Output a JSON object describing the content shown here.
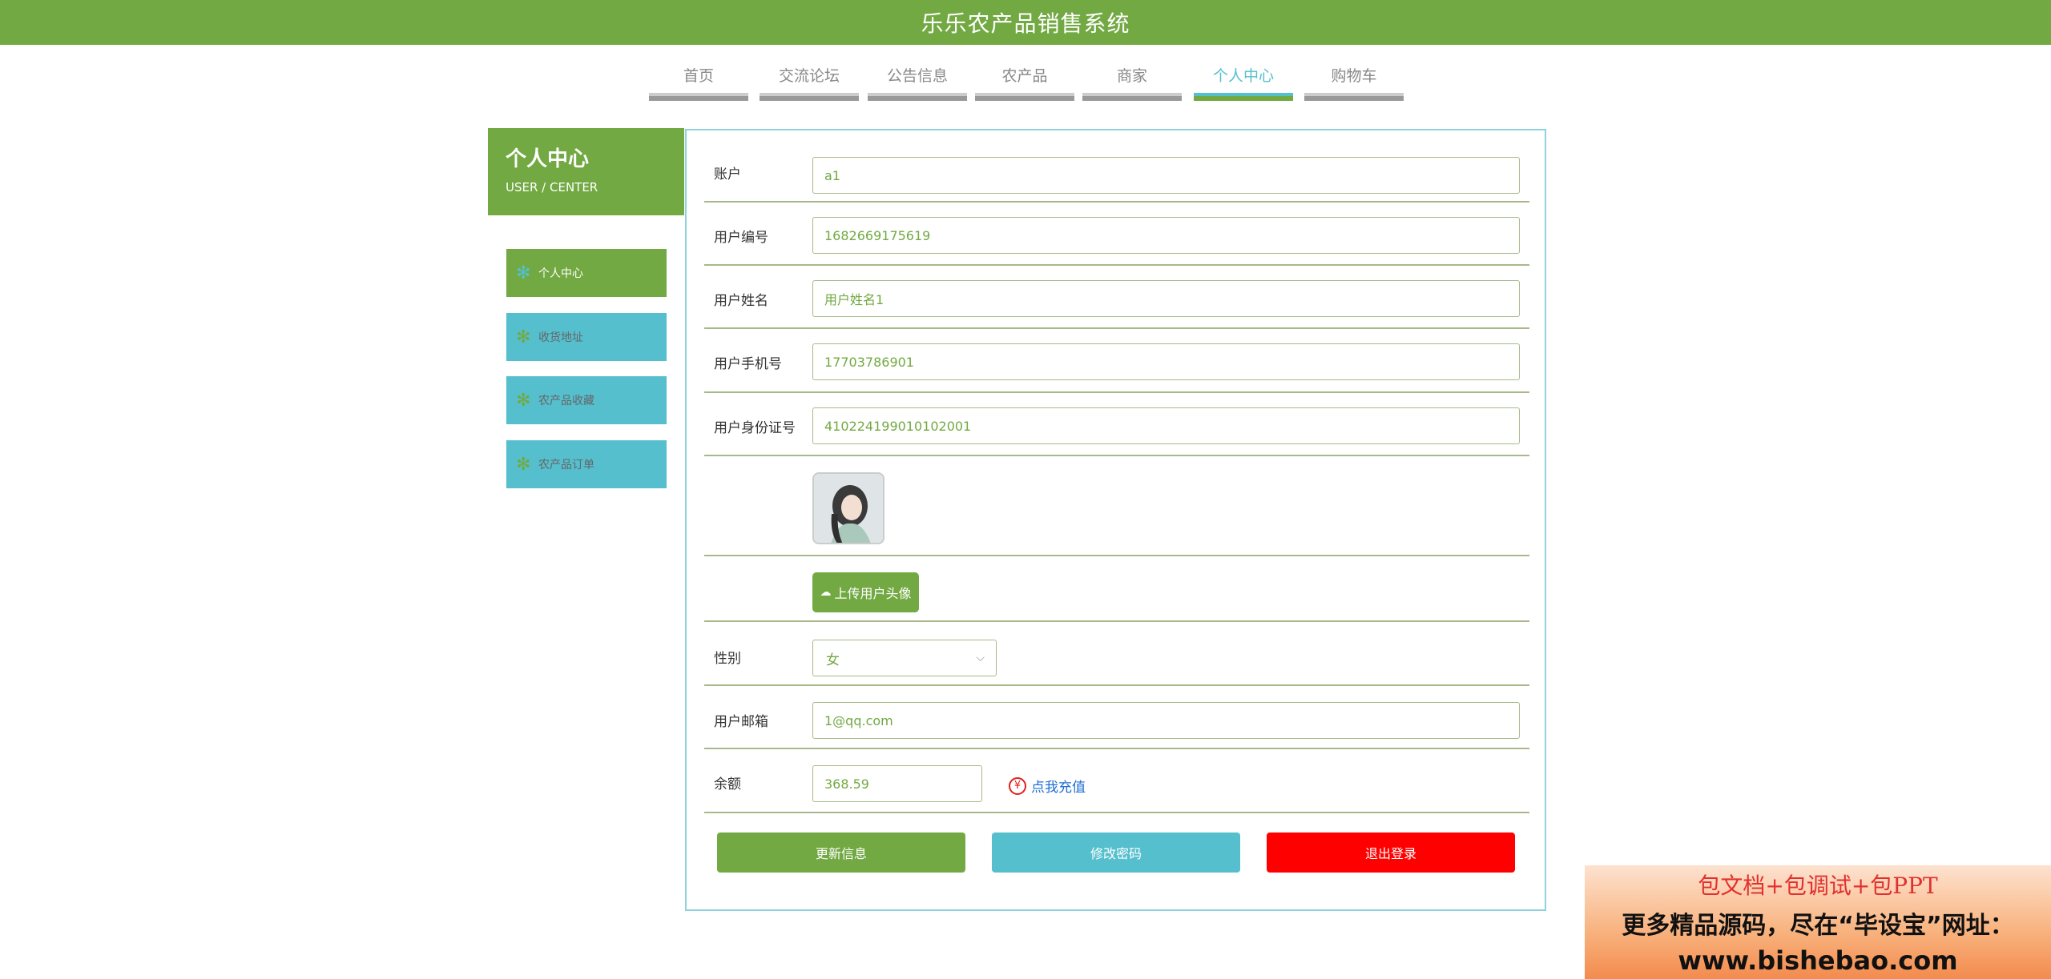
{
  "header": {
    "title": "乐乐农产品销售系统"
  },
  "nav": {
    "items": [
      {
        "label": "首页"
      },
      {
        "label": "交流论坛"
      },
      {
        "label": "公告信息"
      },
      {
        "label": "农产品"
      },
      {
        "label": "商家"
      },
      {
        "label": "个人中心"
      },
      {
        "label": "购物车"
      }
    ],
    "active": "个人中心"
  },
  "sidebar": {
    "title": "个人中心",
    "subtitle": "USER / CENTER",
    "items": [
      {
        "label": "个人中心"
      },
      {
        "label": "收货地址"
      },
      {
        "label": "农产品收藏"
      },
      {
        "label": "农产品订单"
      }
    ]
  },
  "form": {
    "account_label": "账户",
    "account_value": "a1",
    "user_no_label": "用户编号",
    "user_no_value": "1682669175619",
    "name_label": "用户姓名",
    "name_value": "用户姓名1",
    "phone_label": "用户手机号",
    "phone_value": "17703786901",
    "idcard_label": "用户身份证号",
    "idcard_value": "410224199010102001",
    "upload_label": "上传用户头像",
    "gender_label": "性别",
    "gender_value": "女",
    "email_label": "用户邮箱",
    "email_value": "1@qq.com",
    "balance_label": "余额",
    "balance_value": "368.59",
    "recharge_label": "点我充值"
  },
  "actions": {
    "update": "更新信息",
    "change_password": "修改密码",
    "logout": "退出登录"
  },
  "ad": {
    "line1": "包文档+包调试+包PPT",
    "line2": "更多精品源码，尽在“毕设宝”网址：",
    "line3": "www.bishebao.com"
  },
  "colors": {
    "primary_green": "#72a942",
    "cyan": "#55bfce",
    "danger_red": "#ff0000"
  }
}
